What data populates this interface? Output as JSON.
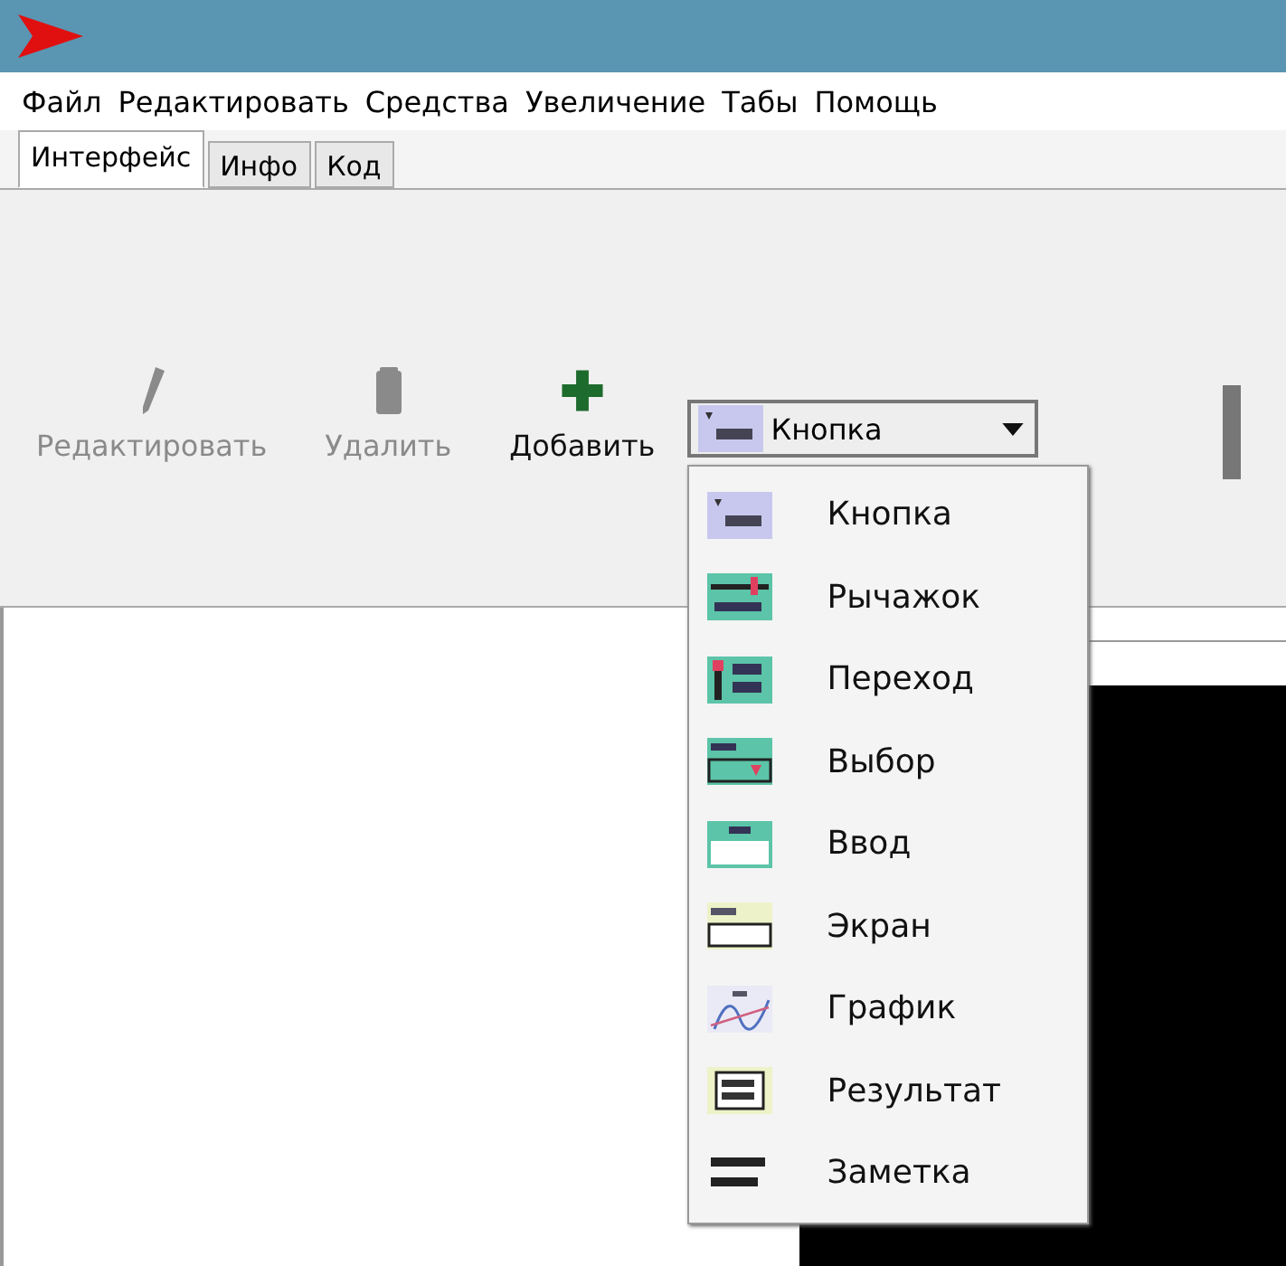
{
  "menu": [
    "Файл",
    "Редактировать",
    "Средства",
    "Увеличение",
    "Табы",
    "Помощь"
  ],
  "tabs": [
    {
      "label": "Интерфейс",
      "selected": true
    },
    {
      "label": "Инфо",
      "selected": false
    },
    {
      "label": "Код",
      "selected": false
    }
  ],
  "toolbar": [
    {
      "kind": "edit",
      "label": "Редактировать",
      "disabled": true
    },
    {
      "kind": "delete",
      "label": "Удалить",
      "disabled": true
    },
    {
      "kind": "add",
      "label": "Добавить",
      "disabled": false
    }
  ],
  "combo": {
    "kind": "button",
    "value": "Кнопка"
  },
  "dropdown": [
    {
      "kind": "button",
      "label": "Кнопка"
    },
    {
      "kind": "slider",
      "label": "Рычажок"
    },
    {
      "kind": "switch",
      "label": "Переход"
    },
    {
      "kind": "choice",
      "label": "Выбор"
    },
    {
      "kind": "input",
      "label": "Ввод"
    },
    {
      "kind": "display",
      "label": "Экран"
    },
    {
      "kind": "graph",
      "label": "График"
    },
    {
      "kind": "result",
      "label": "Результат"
    },
    {
      "kind": "note",
      "label": "Заметка"
    }
  ]
}
